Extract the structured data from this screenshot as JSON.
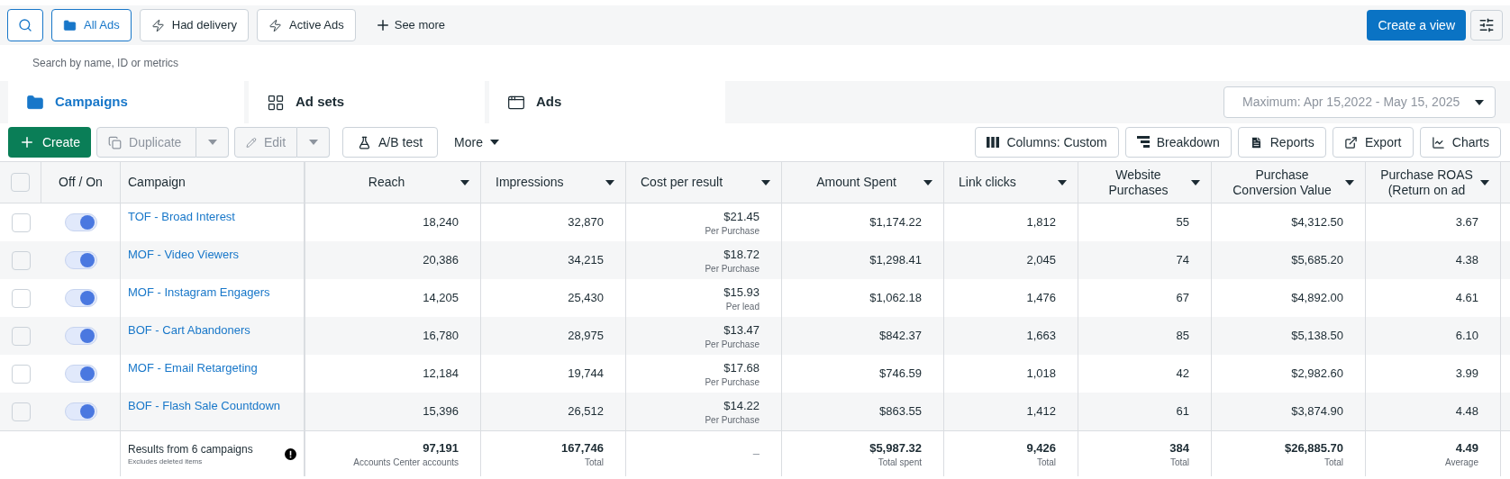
{
  "filters": [
    {
      "kind": "search"
    },
    {
      "kind": "folder",
      "label": "All Ads",
      "selected": true
    },
    {
      "kind": "bolt",
      "label": "Had delivery",
      "selected": false
    },
    {
      "kind": "bolt",
      "label": "Active Ads",
      "selected": false
    },
    {
      "kind": "plus",
      "label": "See more",
      "selected": false
    }
  ],
  "create_view": "Create a view",
  "search": {
    "placeholder": "Search by name, ID or metrics"
  },
  "tabs": [
    {
      "kind": "folder",
      "label": "Campaigns",
      "selected": true
    },
    {
      "kind": "grid",
      "label": "Ad sets",
      "selected": false
    },
    {
      "kind": "window",
      "label": "Ads",
      "selected": false
    }
  ],
  "date_range": "Maximum: Apr 15,2022 - May 15, 2025",
  "toolbar_left": [
    {
      "kind": "create",
      "label": "Create",
      "disabled": false
    },
    {
      "kind": "split",
      "label": "Duplicate",
      "disabled": true
    },
    {
      "kind": "split",
      "label": "Edit",
      "disabled": true
    },
    {
      "kind": "plain",
      "label": "A/B test",
      "disabled": false
    },
    {
      "kind": "menu",
      "label": "More",
      "disabled": false
    }
  ],
  "toolbar_right": [
    {
      "label": "Columns: Custom"
    },
    {
      "label": "Breakdown"
    },
    {
      "label": "Reports"
    },
    {
      "label": "Export"
    },
    {
      "label": "Charts"
    }
  ],
  "table": {
    "select_all_checked": false,
    "toggle_header": "Off / On",
    "campaign_header": "Campaign",
    "metric_columns": [
      {
        "label": "Reach"
      },
      {
        "label": "Impressions"
      },
      {
        "label": "Cost per result"
      },
      {
        "label": "Amount Spent"
      },
      {
        "label": "Link clicks"
      },
      {
        "label": "Website Purchases"
      },
      {
        "label": "Purchase Conversion Value"
      },
      {
        "label": "Purchase ROAS (Return on ad"
      }
    ],
    "rows": [
      {
        "checked": false,
        "on": true,
        "name": "TOF - Broad Interest",
        "cells": [
          {
            "value": "18,240"
          },
          {
            "value": "32,870"
          },
          {
            "value": "$21.45",
            "note": "Per Purchase"
          },
          {
            "value": "$1,174.22"
          },
          {
            "value": "1,812"
          },
          {
            "value": "55"
          },
          {
            "value": "$4,312.50"
          },
          {
            "value": "3.67"
          }
        ]
      },
      {
        "checked": false,
        "on": true,
        "name": "MOF - Video Viewers",
        "cells": [
          {
            "value": "20,386"
          },
          {
            "value": "34,215"
          },
          {
            "value": "$18.72",
            "note": "Per Purchase"
          },
          {
            "value": "$1,298.41"
          },
          {
            "value": "2,045"
          },
          {
            "value": "74"
          },
          {
            "value": "$5,685.20"
          },
          {
            "value": "4.38"
          }
        ]
      },
      {
        "checked": false,
        "on": true,
        "name": "MOF - Instagram Engagers",
        "cells": [
          {
            "value": "14,205"
          },
          {
            "value": "25,430"
          },
          {
            "value": "$15.93",
            "note": "Per lead"
          },
          {
            "value": "$1,062.18"
          },
          {
            "value": "1,476"
          },
          {
            "value": "67"
          },
          {
            "value": "$4,892.00"
          },
          {
            "value": "4.61"
          }
        ]
      },
      {
        "checked": false,
        "on": true,
        "name": "BOF - Cart Abandoners",
        "cells": [
          {
            "value": "16,780"
          },
          {
            "value": "28,975"
          },
          {
            "value": "$13.47",
            "note": "Per Purchase"
          },
          {
            "value": "$842.37"
          },
          {
            "value": "1,663"
          },
          {
            "value": "85"
          },
          {
            "value": "$5,138.50"
          },
          {
            "value": "6.10"
          }
        ]
      },
      {
        "checked": false,
        "on": true,
        "name": "MOF - Email Retargeting",
        "cells": [
          {
            "value": "12,184"
          },
          {
            "value": "19,744"
          },
          {
            "value": "$17.68",
            "note": "Per Purchase"
          },
          {
            "value": "$746.59"
          },
          {
            "value": "1,018"
          },
          {
            "value": "42"
          },
          {
            "value": "$2,982.60"
          },
          {
            "value": "3.99"
          }
        ]
      },
      {
        "checked": false,
        "on": true,
        "name": "BOF - Flash Sale Countdown",
        "cells": [
          {
            "value": "15,396"
          },
          {
            "value": "26,512"
          },
          {
            "value": "$14.22",
            "note": "Per Purchase"
          },
          {
            "value": "$863.55"
          },
          {
            "value": "1,412"
          },
          {
            "value": "61"
          },
          {
            "value": "$3,874.90"
          },
          {
            "value": "4.48"
          }
        ]
      }
    ],
    "footer": {
      "label": "Results from 6 campaigns",
      "note": "Excludes deleted items",
      "cells": [
        {
          "value": "97,191",
          "note": "Accounts Center accounts"
        },
        {
          "value": "167,746",
          "note": "Total"
        },
        {
          "value": "–"
        },
        {
          "value": "$5,987.32",
          "note": "Total spent"
        },
        {
          "value": "9,426",
          "note": "Total"
        },
        {
          "value": "384",
          "note": "Total"
        },
        {
          "value": "$26,885.70",
          "note": "Total"
        },
        {
          "value": "4.49",
          "note": "Average"
        }
      ]
    }
  }
}
